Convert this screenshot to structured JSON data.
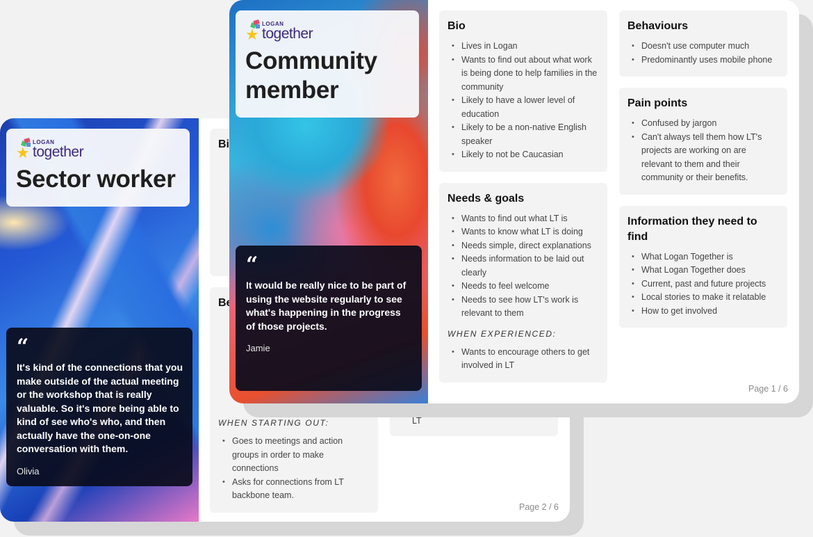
{
  "brand": {
    "logo_small": "LOGAN",
    "logo_big": "together"
  },
  "pages": {
    "community": {
      "title_line1": "Community",
      "title_line2": "member",
      "quote": "It would be really nice to be part of using the website regularly to see what's happening in the progress of those projects.",
      "quote_author": "Jamie",
      "page_label": "Page 1 / 6",
      "bio": {
        "heading": "Bio",
        "items": [
          "Lives in Logan",
          "Wants to find out about what work is being done to help families in the community",
          "Likely to have a lower level of education",
          "Likely to be a non-native English speaker",
          "Likely to not be Caucasian"
        ]
      },
      "needs": {
        "heading": "Needs & goals",
        "items": [
          "Wants to find out what LT is",
          "Wants to know what LT is doing",
          "Needs simple, direct explanations",
          "Needs information to be laid out clearly",
          "Needs to feel welcome",
          "Needs to see how LT's work is relevant to them"
        ],
        "subhead": "WHEN EXPERIENCED:",
        "sub_items": [
          "Wants to encourage others to get involved in LT"
        ]
      },
      "behaviours": {
        "heading": "Behaviours",
        "items": [
          "Doesn't use computer much",
          "Predominantly uses mobile phone"
        ]
      },
      "pain_points": {
        "heading": "Pain points",
        "items": [
          "Confused by jargon",
          "Can't always tell them how LT's projects are working on are relevant to them and their community or their benefits."
        ]
      },
      "info_needed": {
        "heading": "Information they need to find",
        "items": [
          "What Logan Together is",
          "What Logan Together does",
          "Current, past and future projects",
          "Local stories to make it relatable",
          "How to get involved"
        ]
      }
    },
    "sector": {
      "title": "Sector worker",
      "quote": "It's kind of the connections that you make outside of the actual meeting or the workshop that is really valuable. So it's more being able to kind of see who's who, and then actually have the one-on-one conversation with them.",
      "quote_author": "Olivia",
      "page_label": "Page 2 / 6",
      "bio_heading_partial": "Bi",
      "behaviours_heading_partial": "Be",
      "subhead": "WHEN STARTING OUT:",
      "sub_items": [
        "Goes to meetings and action groups in order to make connections",
        "Asks for connections from LT backbone team."
      ],
      "right_col_item": "Wants to get others on board with LT"
    }
  }
}
